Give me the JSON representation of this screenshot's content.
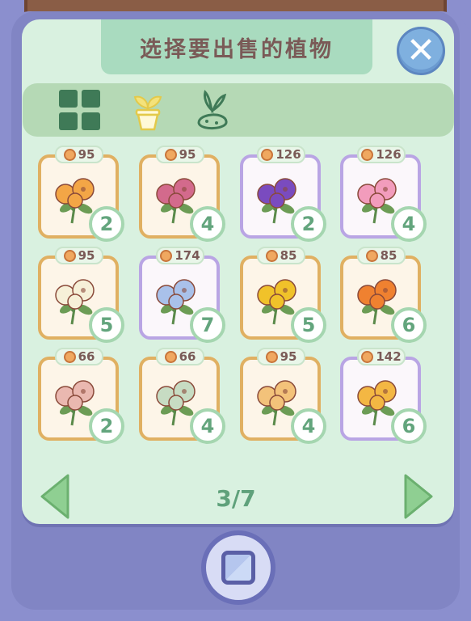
{
  "header": {
    "title": "选择要出售的植物"
  },
  "tabs": [
    {
      "icon": "grid-icon",
      "active": false
    },
    {
      "icon": "pot-icon",
      "active": true
    },
    {
      "icon": "sprout-icon",
      "active": false
    }
  ],
  "items": [
    {
      "price": "95",
      "qty": "2",
      "frame": "gold",
      "flower": "orange-lily",
      "color": "#f3a646"
    },
    {
      "price": "95",
      "qty": "4",
      "frame": "gold",
      "flower": "pink-lily",
      "color": "#d36a8c"
    },
    {
      "price": "126",
      "qty": "2",
      "frame": "purple",
      "flower": "purple-bellflower",
      "color": "#7a4bbf"
    },
    {
      "price": "126",
      "qty": "4",
      "frame": "purple",
      "flower": "pink-lily-cluster",
      "color": "#f29cbc"
    },
    {
      "price": "95",
      "qty": "5",
      "frame": "gold",
      "flower": "white-lily",
      "color": "#f6f0d8"
    },
    {
      "price": "174",
      "qty": "7",
      "frame": "purple",
      "flower": "blue-rose",
      "color": "#a9c1ea"
    },
    {
      "price": "85",
      "qty": "5",
      "frame": "gold",
      "flower": "yellow-bloom",
      "color": "#f0c22a"
    },
    {
      "price": "85",
      "qty": "6",
      "frame": "gold",
      "flower": "orange-bloom",
      "color": "#ef8130"
    },
    {
      "price": "66",
      "qty": "2",
      "frame": "gold",
      "flower": "pink-succulent",
      "color": "#eab8b0"
    },
    {
      "price": "66",
      "qty": "4",
      "frame": "gold",
      "flower": "green-succulent",
      "color": "#c7dcc3"
    },
    {
      "price": "95",
      "qty": "4",
      "frame": "gold",
      "flower": "striped-lily",
      "color": "#f3c27a"
    },
    {
      "price": "142",
      "qty": "6",
      "frame": "purple",
      "flower": "yellow-daffodil",
      "color": "#f3b743"
    }
  ],
  "pagination": {
    "label": "3/7"
  },
  "colors": {
    "accent": "#5fa17b",
    "panel": "#d9f1e0",
    "device": "#8b8fce"
  }
}
